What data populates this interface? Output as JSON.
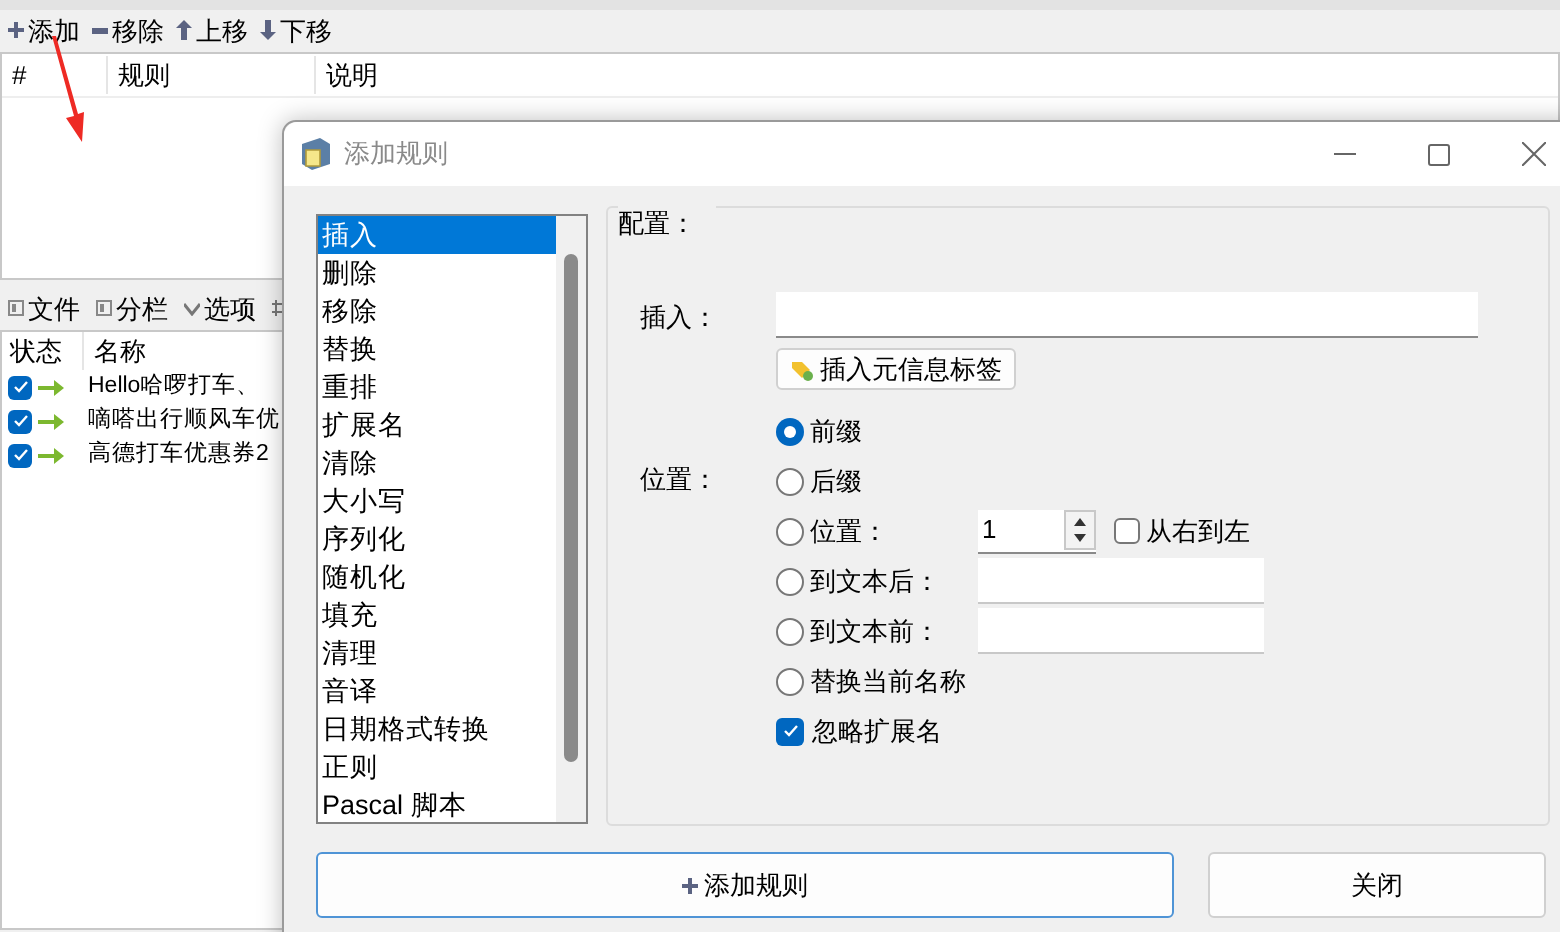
{
  "main_toolbar": [
    {
      "kind": "add",
      "label": "添加"
    },
    {
      "kind": "remove",
      "label": "移除"
    },
    {
      "kind": "up",
      "label": "上移"
    },
    {
      "kind": "down",
      "label": "下移"
    }
  ],
  "rules_table": {
    "columns": [
      "#",
      "规则",
      "说明"
    ]
  },
  "files_toolbar": [
    {
      "kind": "files",
      "label": "文件"
    },
    {
      "kind": "columns",
      "label": "分栏"
    },
    {
      "kind": "options",
      "label": "选项"
    },
    {
      "kind": "export"
    }
  ],
  "files_table": {
    "columns": [
      "状态",
      "名称"
    ],
    "rows": [
      {
        "checked": true,
        "name": "Hello哈啰打车、"
      },
      {
        "checked": true,
        "name": "嘀嗒出行顺风车优"
      },
      {
        "checked": true,
        "name": "高德打车优惠券2"
      }
    ]
  },
  "dialog": {
    "title": "添加规则",
    "rule_list": [
      {
        "label": "插入",
        "selected": true
      },
      {
        "label": "删除",
        "selected": false
      },
      {
        "label": "移除",
        "selected": false
      },
      {
        "label": "替换",
        "selected": false
      },
      {
        "label": "重排",
        "selected": false
      },
      {
        "label": "扩展名",
        "selected": false
      },
      {
        "label": "清除",
        "selected": false
      },
      {
        "label": "大小写",
        "selected": false
      },
      {
        "label": "序列化",
        "selected": false
      },
      {
        "label": "随机化",
        "selected": false
      },
      {
        "label": "填充",
        "selected": false
      },
      {
        "label": "清理",
        "selected": false
      },
      {
        "label": "音译",
        "selected": false
      },
      {
        "label": "日期格式转换",
        "selected": false
      },
      {
        "label": "正则",
        "selected": false
      },
      {
        "label": "Pascal 脚本",
        "selected": false
      }
    ],
    "config": {
      "legend": "配置：",
      "insert_label": "插入：",
      "meta_button": "插入元信息标签",
      "position_label": "位置：",
      "options": [
        {
          "kind": "radio",
          "label": "前缀",
          "selected": true
        },
        {
          "kind": "radio",
          "label": "后缀",
          "selected": false
        },
        {
          "kind": "spin",
          "label": "位置：",
          "selected": false,
          "value": "1",
          "checkbox": {
            "label": "从右到左",
            "checked": false
          }
        },
        {
          "kind": "field",
          "label": "到文本后：",
          "selected": false
        },
        {
          "kind": "field",
          "label": "到文本前：",
          "selected": false
        },
        {
          "kind": "radio",
          "label": "替换当前名称",
          "selected": false
        }
      ],
      "ignore_ext": {
        "label": "忽略扩展名",
        "checked": true
      }
    },
    "buttons": [
      {
        "kind": "primary",
        "label": "添加规则"
      },
      {
        "kind": "default",
        "label": "关闭"
      }
    ]
  }
}
